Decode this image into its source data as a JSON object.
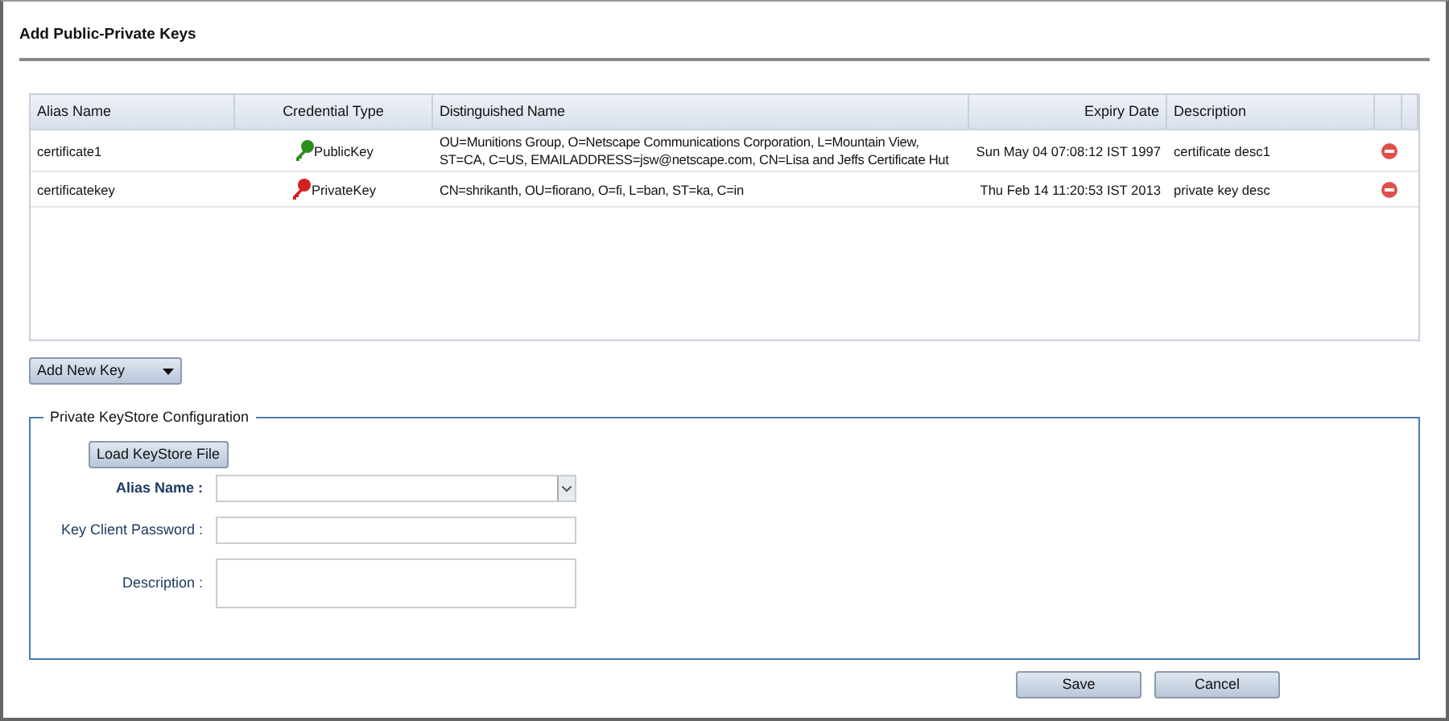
{
  "window": {
    "title": "Add Public-Private Keys"
  },
  "table": {
    "columns": [
      "Alias Name",
      "Credential Type",
      "Distinguished Name",
      "Expiry Date",
      "Description"
    ],
    "rows": [
      {
        "alias": "certificate1",
        "kind": "public",
        "credential_type": "PublicKey",
        "distinguished_name": "OU=Munitions Group, O=Netscape Communications Corporation, L=Mountain View, ST=CA, C=US, EMAILADDRESS=jsw@netscape.com, CN=Lisa and Jeffs Certificate Hut",
        "expiry_date": "Sun May 04 07:08:12 IST 1997",
        "description": "certificate desc1"
      },
      {
        "alias": "certificatekey",
        "kind": "private",
        "credential_type": "PrivateKey",
        "distinguished_name": "CN=shrikanth, OU=fiorano, O=fi, L=ban, ST=ka, C=in",
        "expiry_date": "Thu Feb 14 11:20:53 IST 2013",
        "description": "private key desc"
      }
    ]
  },
  "add_button": "Add New Key",
  "keystore": {
    "legend": "Private KeyStore Configuration",
    "load_button": "Load KeyStore File",
    "fields": [
      {
        "label": "Alias Name :",
        "kind": "select",
        "emphasized": true
      },
      {
        "label": "Key Client Password :",
        "kind": "password",
        "emphasized": false
      },
      {
        "label": "Description :",
        "kind": "textarea",
        "emphasized": false
      }
    ]
  },
  "buttons": [
    "Save",
    "Cancel"
  ]
}
